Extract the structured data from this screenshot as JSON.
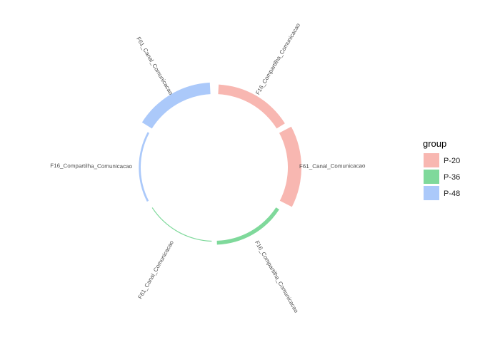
{
  "chart_data": {
    "type": "circular-bar",
    "legend": {
      "title": "group",
      "position": "right",
      "entries": [
        {
          "label": "P-20",
          "color": "#F8B7B1"
        },
        {
          "label": "P-36",
          "color": "#7FD99B"
        },
        {
          "label": "P-48",
          "color": "#ABC9FA"
        }
      ]
    },
    "segments": [
      {
        "category": "F16_Compartilha_Comunicacao",
        "group": "P-20",
        "value": 5
      },
      {
        "category": "F61_Canal_Comunicacao",
        "group": "P-20",
        "value": 7
      },
      {
        "category": "F16_Compartilha_Comunicacao",
        "group": "P-36",
        "value": 2
      },
      {
        "category": "F61_Canal_Comunicacao",
        "group": "P-36",
        "value": 0
      },
      {
        "category": "F16_Compartilha_Comunicacao",
        "group": "P-48",
        "value": 1
      },
      {
        "category": "F61_Canal_Comunicacao",
        "group": "P-48",
        "value": 6
      }
    ],
    "grid": false
  }
}
